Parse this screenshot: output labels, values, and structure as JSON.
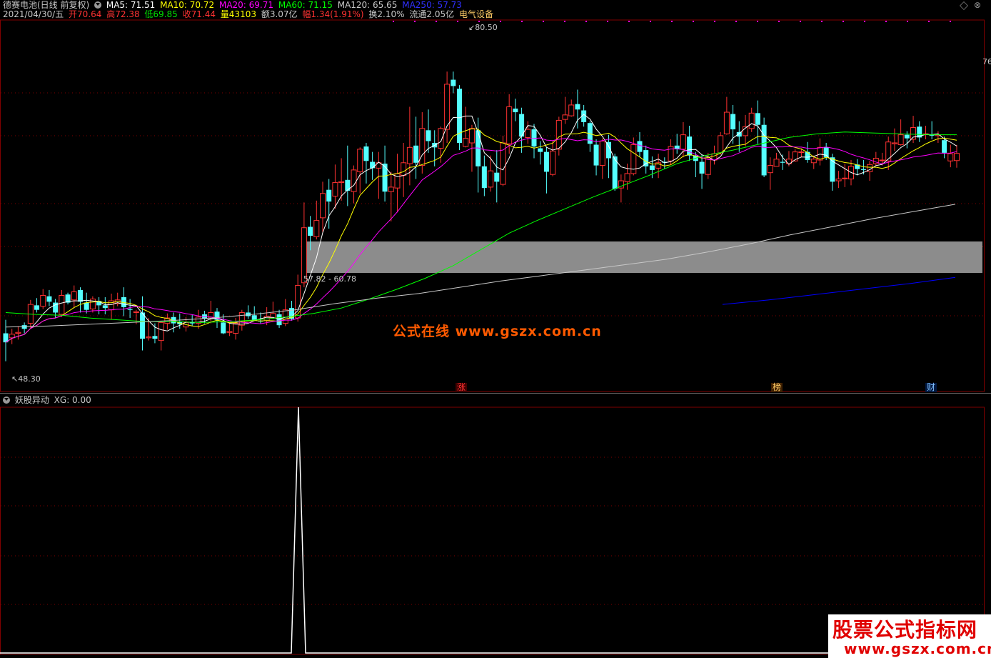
{
  "header": {
    "stock": "德赛电池(日线 前复权)",
    "ma5": "MA5: 71.51",
    "ma10": "MA10: 70.72",
    "ma20": "MA20: 69.71",
    "ma60": "MA60: 71.15",
    "ma120": "MA120: 65.65",
    "ma250": "MA250: 57.73",
    "date": "2021/04/30/五",
    "open": "开70.64",
    "high": "高72.38",
    "low": "低69.85",
    "close": "收71.44",
    "volume": "量43103",
    "amount": "额3.07亿",
    "change": "幅1.34(1.91%)",
    "turnover": "换2.10%",
    "float": "流通2.05亿",
    "sector": "电气设备"
  },
  "annotations": {
    "high_label": "80.50",
    "low_label": "48.30",
    "band_label": "57.82 - 60.78",
    "right_axis_label": "76",
    "watermark": "公式在线  www.gszx.com.cn",
    "tag_zhang": "涨",
    "tag_bang": "榜",
    "tag_cai": "财"
  },
  "indicator": {
    "title": "妖股异动",
    "value": "XG: 0.00"
  },
  "logo": {
    "line1": "股票公式指标网",
    "line2": "www.gszx.com.cn"
  },
  "colors": {
    "up": "#ff3232",
    "down": "#54ffff",
    "ma5": "#ffffff",
    "ma10": "#ffff00",
    "ma20": "#ff00ff",
    "ma60": "#00ff00",
    "ma120": "#c8c8c8",
    "ma250": "#0000ff",
    "grid": "#800000"
  },
  "chart_data": [
    {
      "type": "candlestick",
      "title": "德赛电池(日线 前复权)",
      "ylim": [
        46,
        84
      ],
      "range_band": [
        57.82,
        60.78
      ],
      "max_label": 80.5,
      "min_label": 48.3,
      "candles": [
        [
          51.5,
          50.5,
          53.0,
          48.4
        ],
        [
          51.0,
          51.4,
          52.0,
          50.3
        ],
        [
          51.5,
          51.6,
          52.3,
          50.8
        ],
        [
          52.4,
          52.0,
          52.7,
          51.5
        ],
        [
          52.6,
          54.7,
          55.2,
          52.1
        ],
        [
          54.6,
          54.1,
          55.4,
          53.8
        ],
        [
          54.5,
          55.7,
          56.4,
          54.2
        ],
        [
          55.6,
          55.0,
          56.3,
          54.5
        ],
        [
          54.9,
          53.8,
          55.3,
          53.2
        ],
        [
          53.6,
          55.7,
          56.3,
          53.3
        ],
        [
          55.8,
          54.9,
          56.0,
          54.7
        ],
        [
          55.2,
          56.1,
          56.8,
          54.3
        ],
        [
          56.3,
          55.0,
          56.6,
          53.8
        ],
        [
          54.9,
          54.1,
          56.0,
          53.7
        ],
        [
          54.2,
          55.3,
          55.6,
          53.8
        ],
        [
          55.1,
          54.6,
          55.5,
          53.6
        ],
        [
          54.6,
          54.3,
          55.5,
          53.6
        ],
        [
          54.1,
          55.1,
          55.9,
          53.0
        ],
        [
          54.8,
          55.2,
          56.0,
          54.5
        ],
        [
          55.5,
          54.4,
          56.6,
          53.4
        ],
        [
          54.2,
          54.1,
          55.3,
          53.2
        ],
        [
          53.8,
          53.9,
          54.1,
          52.5
        ],
        [
          53.8,
          50.9,
          55.6,
          49.6
        ],
        [
          51.0,
          51.1,
          53.2,
          50.7
        ],
        [
          51.2,
          50.9,
          52.6,
          50.4
        ],
        [
          50.7,
          52.7,
          52.8,
          49.6
        ],
        [
          52.6,
          53.2,
          53.7,
          51.9
        ],
        [
          53.3,
          52.6,
          53.8,
          51.6
        ],
        [
          52.8,
          52.5,
          53.7,
          52.0
        ],
        [
          52.2,
          52.7,
          53.3,
          51.7
        ],
        [
          52.7,
          52.6,
          53.6,
          52.3
        ],
        [
          52.6,
          53.3,
          54.1,
          52.0
        ],
        [
          53.6,
          53.1,
          54.0,
          52.6
        ],
        [
          53.2,
          53.8,
          55.1,
          52.6
        ],
        [
          53.9,
          53.0,
          54.3,
          52.1
        ],
        [
          52.7,
          51.5,
          53.6,
          51.4
        ],
        [
          51.6,
          51.7,
          52.6,
          51.2
        ],
        [
          51.5,
          52.6,
          53.2,
          50.8
        ],
        [
          52.4,
          53.8,
          54.1,
          51.8
        ],
        [
          53.8,
          53.4,
          54.6,
          53.1
        ],
        [
          53.5,
          53.0,
          54.5,
          52.9
        ],
        [
          52.9,
          52.8,
          53.8,
          52.6
        ],
        [
          52.9,
          53.4,
          54.4,
          52.4
        ],
        [
          53.2,
          53.7,
          55.0,
          53.1
        ],
        [
          53.6,
          52.4,
          54.1,
          52.1
        ],
        [
          52.6,
          54.1,
          55.3,
          52.3
        ],
        [
          54.3,
          53.1,
          55.1,
          52.9
        ],
        [
          53.2,
          56.8,
          58.0,
          52.8
        ],
        [
          57.1,
          63.2,
          66.0,
          56.6
        ],
        [
          63.3,
          62.3,
          64.5,
          60.7
        ],
        [
          62.2,
          64.0,
          66.2,
          61.9
        ],
        [
          64.3,
          67.0,
          68.3,
          62.7
        ],
        [
          67.4,
          66.1,
          68.6,
          63.1
        ],
        [
          66.7,
          68.2,
          70.2,
          65.3
        ],
        [
          68.2,
          68.3,
          70.9,
          66.2
        ],
        [
          68.5,
          67.3,
          72.3,
          65.6
        ],
        [
          67.2,
          69.6,
          70.1,
          65.9
        ],
        [
          69.4,
          71.9,
          72.1,
          67.0
        ],
        [
          72.2,
          70.6,
          72.6,
          68.1
        ],
        [
          70.5,
          69.8,
          71.6,
          68.5
        ],
        [
          69.8,
          70.4,
          71.6,
          66.4
        ],
        [
          70.3,
          67.2,
          72.3,
          66.1
        ],
        [
          67.2,
          67.7,
          69.4,
          63.9
        ],
        [
          67.6,
          69.2,
          71.4,
          64.9
        ],
        [
          69.0,
          70.4,
          72.6,
          66.6
        ],
        [
          70.3,
          72.1,
          76.6,
          67.9
        ],
        [
          72.3,
          70.4,
          75.5,
          68.6
        ],
        [
          70.1,
          74.2,
          76.0,
          69.2
        ],
        [
          74.0,
          72.8,
          76.3,
          71.5
        ],
        [
          72.6,
          72.1,
          74.0,
          70.0
        ],
        [
          72.0,
          74.2,
          74.4,
          70.4
        ],
        [
          74.1,
          79.1,
          80.5,
          72.6
        ],
        [
          79.6,
          78.9,
          80.5,
          78.1
        ],
        [
          78.6,
          72.6,
          79.0,
          71.8
        ],
        [
          72.2,
          73.1,
          76.6,
          72.1
        ],
        [
          72.6,
          74.2,
          74.6,
          69.4
        ],
        [
          74.0,
          70.0,
          75.4,
          67.1
        ],
        [
          70.0,
          67.6,
          71.2,
          66.7
        ],
        [
          67.7,
          69.5,
          71.2,
          67.2
        ],
        [
          69.3,
          68.3,
          71.8,
          66.0
        ],
        [
          68.0,
          72.6,
          73.4,
          67.8
        ],
        [
          72.5,
          76.6,
          78.0,
          71.4
        ],
        [
          76.4,
          76.0,
          77.5,
          75.0
        ],
        [
          75.8,
          73.3,
          76.5,
          71.5
        ],
        [
          73.2,
          74.1,
          75.0,
          72.5
        ],
        [
          74.1,
          72.2,
          74.7,
          70.9
        ],
        [
          72.0,
          71.6,
          72.8,
          70.2
        ],
        [
          71.6,
          69.4,
          72.1,
          67.0
        ],
        [
          69.1,
          71.7,
          72.8,
          68.9
        ],
        [
          71.9,
          75.1,
          75.5,
          71.2
        ],
        [
          75.2,
          75.7,
          77.7,
          74.7
        ],
        [
          75.6,
          76.8,
          77.4,
          75.5
        ],
        [
          76.9,
          76.3,
          78.5,
          74.2
        ],
        [
          76.2,
          74.9,
          76.8,
          74.4
        ],
        [
          74.8,
          72.5,
          75.0,
          71.6
        ],
        [
          72.4,
          70.1,
          73.0,
          69.0
        ],
        [
          70.1,
          72.8,
          73.1,
          68.6
        ],
        [
          72.7,
          70.9,
          73.5,
          68.7
        ],
        [
          71.1,
          67.5,
          71.4,
          67.3
        ],
        [
          67.6,
          68.4,
          69.1,
          66.0
        ],
        [
          68.3,
          69.2,
          70.3,
          67.4
        ],
        [
          69.2,
          72.4,
          73.2,
          69.0
        ],
        [
          72.8,
          71.6,
          73.8,
          71.1
        ],
        [
          71.8,
          70.0,
          72.3,
          69.2
        ],
        [
          70.1,
          69.6,
          71.1,
          68.7
        ],
        [
          69.8,
          70.4,
          71.4,
          68.7
        ],
        [
          70.5,
          70.4,
          71.0,
          69.7
        ],
        [
          70.6,
          72.2,
          73.0,
          70.2
        ],
        [
          72.3,
          71.9,
          73.6,
          71.4
        ],
        [
          71.9,
          73.5,
          74.9,
          71.0
        ],
        [
          73.3,
          71.2,
          74.5,
          70.6
        ],
        [
          71.2,
          70.6,
          71.6,
          68.8
        ],
        [
          70.5,
          69.2,
          71.3,
          67.5
        ],
        [
          69.1,
          70.8,
          71.5,
          68.6
        ],
        [
          70.7,
          71.4,
          72.3,
          70.2
        ],
        [
          71.5,
          73.4,
          73.8,
          71.3
        ],
        [
          73.6,
          76.0,
          77.7,
          73.5
        ],
        [
          75.8,
          74.1,
          76.8,
          72.5
        ],
        [
          73.8,
          73.3,
          75.0,
          71.6
        ],
        [
          73.4,
          74.4,
          75.7,
          72.2
        ],
        [
          74.2,
          75.9,
          76.5,
          73.8
        ],
        [
          75.9,
          74.6,
          77.3,
          72.5
        ],
        [
          74.6,
          69.0,
          75.4,
          68.8
        ],
        [
          69.3,
          70.1,
          71.0,
          67.4
        ],
        [
          70.0,
          70.8,
          71.5,
          70.3
        ],
        [
          70.5,
          70.4,
          71.3,
          69.6
        ],
        [
          70.3,
          70.8,
          71.7,
          70.0
        ],
        [
          70.6,
          71.6,
          71.9,
          70.5
        ],
        [
          71.6,
          71.6,
          72.0,
          71.0
        ],
        [
          71.6,
          70.7,
          72.7,
          70.4
        ],
        [
          70.4,
          70.8,
          71.2,
          69.7
        ],
        [
          70.7,
          72.1,
          73.1,
          70.1
        ],
        [
          72.1,
          71.0,
          72.6,
          70.7
        ],
        [
          71.0,
          68.3,
          71.4,
          67.3
        ],
        [
          68.4,
          68.6,
          69.5,
          67.6
        ],
        [
          68.7,
          68.7,
          70.3,
          67.7
        ],
        [
          68.6,
          70.0,
          70.7,
          67.9
        ],
        [
          70.2,
          69.7,
          70.8,
          69.0
        ],
        [
          69.7,
          69.6,
          70.7,
          69.1
        ],
        [
          69.4,
          70.2,
          70.6,
          68.4
        ],
        [
          70.3,
          70.9,
          71.6,
          70.1
        ],
        [
          70.7,
          70.7,
          71.5,
          70.1
        ],
        [
          70.6,
          72.7,
          73.3,
          69.6
        ],
        [
          72.5,
          72.6,
          74.2,
          71.7
        ],
        [
          72.4,
          73.5,
          75.2,
          72.3
        ],
        [
          73.5,
          73.1,
          73.9,
          72.0
        ],
        [
          73.0,
          74.3,
          75.6,
          72.6
        ],
        [
          74.4,
          73.2,
          75.0,
          72.7
        ],
        [
          73.6,
          73.6,
          74.5,
          73.0
        ],
        [
          73.5,
          73.4,
          75.0,
          73.0
        ],
        [
          73.4,
          73.5,
          73.9,
          72.6
        ],
        [
          72.9,
          71.5,
          73.3,
          70.9
        ],
        [
          70.6,
          71.4,
          72.4,
          69.9
        ],
        [
          70.64,
          71.44,
          72.38,
          69.85
        ]
      ],
      "ma60_y": [
        53.8,
        53.6,
        53.5,
        53.2,
        53.0,
        52.8,
        52.8,
        52.7,
        52.8,
        53.0,
        53.3,
        53.7,
        54.3,
        55.3,
        56.4,
        57.6,
        59.0,
        60.8,
        62.6,
        64.0,
        65.3,
        66.6,
        67.8,
        69.0,
        70.3,
        71.2,
        71.8,
        72.5,
        73.2,
        73.6,
        73.8,
        73.7,
        73.6,
        73.5,
        73.5
      ],
      "ma120_y": [
        52.2,
        52.3,
        52.5,
        52.7,
        52.9,
        53.2,
        53.6,
        54.1,
        54.8,
        55.4,
        55.9,
        56.6,
        57.3,
        57.9,
        58.5,
        59.1,
        59.7,
        60.5,
        61.4,
        62.4,
        63.3,
        64.2,
        65.0,
        65.8
      ],
      "ma250_y": [
        54.7,
        55.2,
        55.8,
        56.4,
        57.0,
        57.7
      ]
    },
    {
      "type": "line",
      "title": "妖股异动",
      "series": [
        {
          "name": "XG",
          "values": [
            0,
            0,
            1,
            0,
            0
          ]
        }
      ],
      "ylim": [
        0,
        1
      ]
    }
  ]
}
